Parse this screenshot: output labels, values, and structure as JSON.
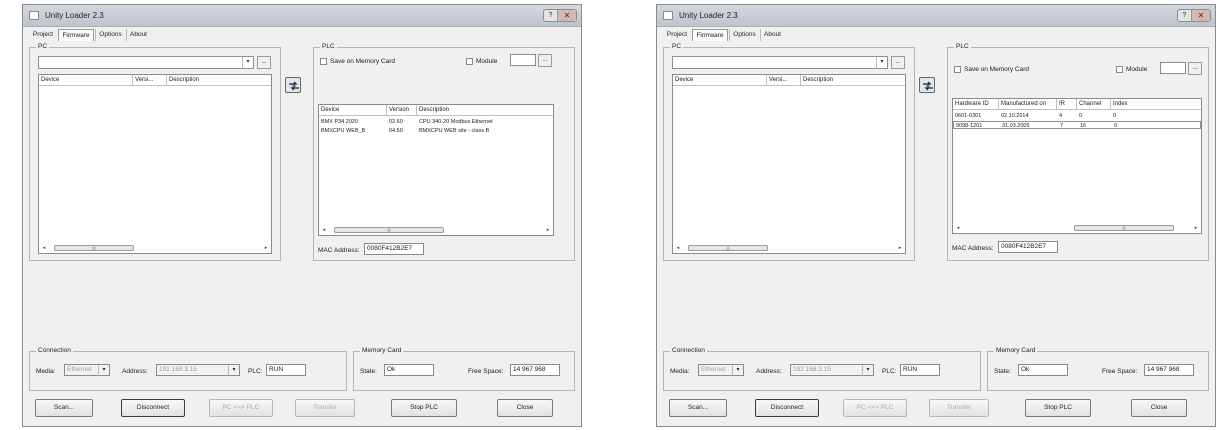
{
  "window_title": "Unity Loader 2.3",
  "window_help_label": "?",
  "window_close_label": "✕",
  "tabs": [
    "Project",
    "Firmware",
    "Options",
    "About"
  ],
  "pc_group": {
    "title": "PC"
  },
  "plc_group": {
    "title": "PLC",
    "save_memory_card_label": "Save on Memory Card",
    "module_label": "Module"
  },
  "pc_list": {
    "columns": [
      "Device",
      "Versi...",
      "Description"
    ]
  },
  "combo_arrow": "▾",
  "dots": "...",
  "scroll": {
    "left": "◂",
    "right": "▸",
    "thumb": "|||"
  },
  "left_panel": {
    "plc_columns": [
      "Device",
      "Version",
      "Description"
    ],
    "plc_rows": [
      [
        "BMX P34 2020",
        "02.60",
        "CPU 340-20 Modbus Ethernet"
      ],
      [
        "BMXCPU WEB_B",
        "04.50",
        "BMXCPU WEB site - class B"
      ]
    ]
  },
  "right_panel": {
    "plc_columns": [
      "Hardware ID",
      "Manufactured on",
      "IR",
      "Channel",
      "Index"
    ],
    "plc_rows": [
      [
        "0601-0301",
        "02.10.2014",
        "4",
        "0",
        "0"
      ],
      [
        "9098-1201",
        "31.03.2005",
        "7",
        "16",
        "0"
      ]
    ]
  },
  "mac": {
    "label": "MAC Address:",
    "value": "0080F412B2E7"
  },
  "connection": {
    "title": "Connection",
    "media_label": "Media:",
    "media_value": "Ethernet",
    "address_label": "Address:",
    "address_value": "192.168.3.15",
    "plc_label": "PLC:",
    "plc_value": "RUN"
  },
  "memory_card": {
    "title": "Memory Card",
    "state_label": "State:",
    "state_value": "Ok",
    "free_space_label": "Free Space:",
    "free_space_value": "14 967 968"
  },
  "buttons": {
    "scan": "Scan...",
    "disconnect": "Disconnect",
    "pc_to_plc": "PC <=> PLC",
    "transfer": "Transfer",
    "stop_plc": "Stop PLC",
    "close": "Close"
  }
}
